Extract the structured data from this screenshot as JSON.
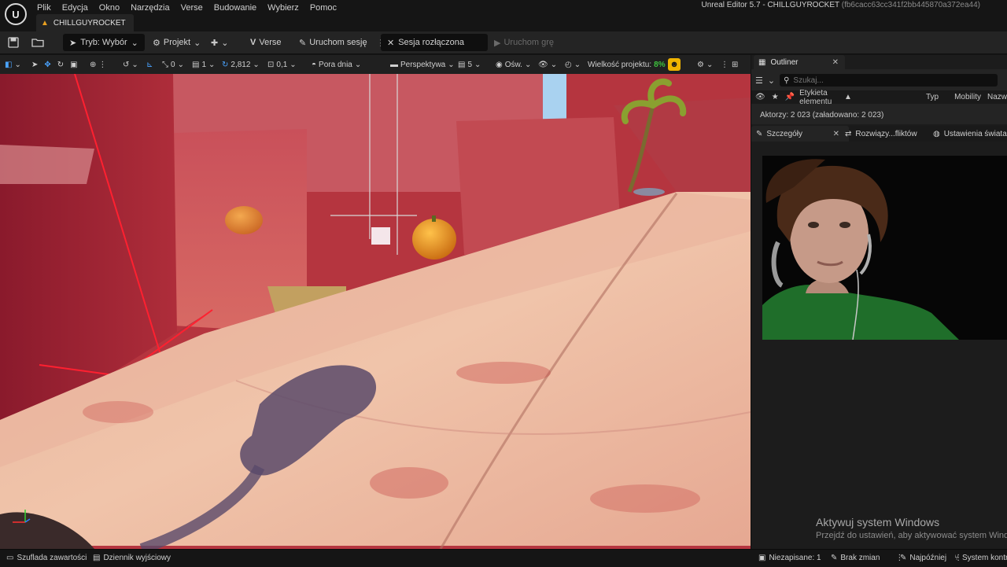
{
  "app": {
    "window_title": "Unreal Editor 5.7 - CHILLGUYROCKET",
    "window_hash": "(fb6cacc63cc341f2bb445870a372ea44)",
    "logo_glyph": "U"
  },
  "menu": [
    "Plik",
    "Edycja",
    "Okno",
    "Narzędzia",
    "Verse",
    "Budowanie",
    "Wybierz",
    "Pomoc"
  ],
  "project_tab": {
    "label": "CHILLGUYROCKET"
  },
  "toolbar": {
    "mode_label": "Tryb: Wybór",
    "project_label": "Projekt",
    "verse_label": "Verse",
    "launch_session_label": "Uruchom sesję",
    "session_status_label": "Sesja rozłączona",
    "launch_game_label": "Uruchom grę"
  },
  "viewport_toolbar": {
    "grid_value": "0",
    "rotation_snap": "1",
    "scale_value": "2,812",
    "angle_value": "0,1",
    "time_of_day_label": "Pora dnia",
    "perspective_label": "Perspektywa",
    "speed_value": "5",
    "lighting_label": "Ośw.",
    "project_size_label": "Wielkość projektu:",
    "project_size_value": "8%"
  },
  "outliner": {
    "tab_label": "Outliner",
    "search_placeholder": "Szukaj...",
    "col_label": "Etykieta elementu",
    "col_type": "Typ",
    "col_mobility": "Mobility",
    "col_extra": "Nazw",
    "actors_text": "Aktorzy: 2 023 (załadowano: 2 023)"
  },
  "details_tabs": {
    "details_label": "Szczegóły",
    "conflicts_label": "Rozwiązy...fliktów",
    "world_settings_label": "Ustawienia świata"
  },
  "activation": {
    "title": "Aktywuj system Windows",
    "subtitle": "Przejdź do ustawień, aby aktywować system Windows."
  },
  "statusbar": {
    "content_drawer": "Szuflada zawartości",
    "output_log": "Dziennik wyjściowy",
    "unsaved": "Niezapisane: 1",
    "no_changes": "Brak zmian",
    "latest": "Najpóźniej",
    "source_control": "System kontroli"
  },
  "colors": {
    "accent_orange": "#e8a020",
    "size_green": "#3ec43e",
    "warning_yellow": "#f0b400"
  }
}
